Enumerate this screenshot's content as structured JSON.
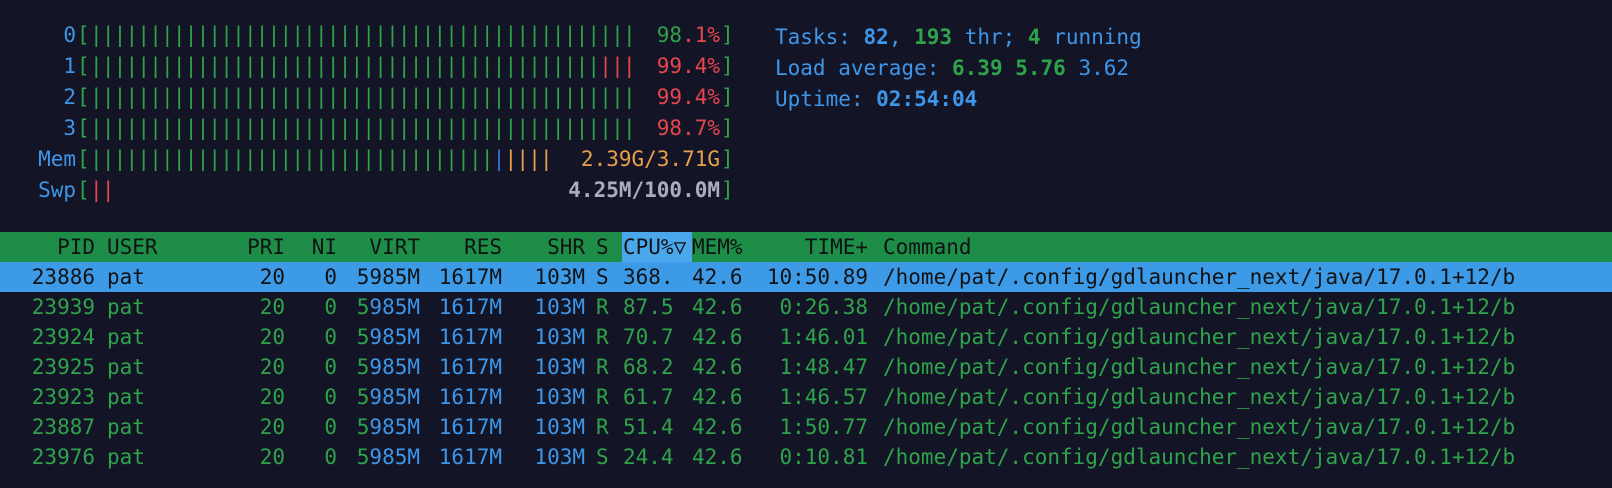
{
  "meters": [
    {
      "label": "0",
      "green": 46,
      "red": 0,
      "blue": 0,
      "yellow": 0,
      "value_pre": "98",
      "value_post": ".1%"
    },
    {
      "label": "1",
      "green": 43,
      "red": 3,
      "blue": 0,
      "yellow": 0,
      "value_pre": "",
      "value_post": "99.4%"
    },
    {
      "label": "2",
      "green": 46,
      "red": 0,
      "blue": 0,
      "yellow": 0,
      "value_pre": "",
      "value_post": "99.4%"
    },
    {
      "label": "3",
      "green": 46,
      "red": 0,
      "blue": 0,
      "yellow": 0,
      "value_pre": "",
      "value_post": "98.7%"
    },
    {
      "label": "Mem",
      "green": 34,
      "red": 0,
      "blue": 1,
      "yellow": 4,
      "value_pre": "",
      "value_post": "2.39G/3.71G"
    },
    {
      "label": "Swp",
      "green": 0,
      "red": 2,
      "blue": 0,
      "yellow": 0,
      "value_pre": "",
      "value_post": "4.25M/100.0M"
    }
  ],
  "info": {
    "tasks_label": "Tasks: ",
    "tasks": "82",
    "sep1": ", ",
    "threads": "193",
    "thr_label": " thr; ",
    "running": "4",
    "running_label": " running",
    "load_label": "Load average: ",
    "load1": "6.39",
    "load5": "5.76",
    "load15": "3.62",
    "uptime_label": "Uptime: ",
    "uptime": "02:54:04"
  },
  "columns": {
    "pid": "PID",
    "user": "USER",
    "pri": "PRI",
    "ni": "NI",
    "virt": "VIRT",
    "res": "RES",
    "shr": "SHR",
    "s": "S",
    "cpu": "CPU%▽",
    "mem": "MEM%",
    "time": "TIME+",
    "command": "Command"
  },
  "processes": [
    {
      "pid": "23886",
      "user": "pat",
      "pri": "20",
      "ni": "0",
      "virt_a": "5",
      "virt_b": "985M",
      "res_a": "1617M",
      "res_b": "",
      "shr": "103M",
      "s": "S",
      "cpu": "368.",
      "mem": "42.6",
      "time": "10:50.89",
      "command": "/home/pat/.config/gdlauncher_next/java/17.0.1+12/b"
    },
    {
      "pid": "23939",
      "user": "pat",
      "pri": "20",
      "ni": "0",
      "virt_a": "5",
      "virt_b": "985M",
      "res_a": "1617M",
      "res_b": "",
      "shr": "103M",
      "s": "R",
      "cpu": "87.5",
      "mem": "42.6",
      "time": "0:26.38",
      "command": "/home/pat/.config/gdlauncher_next/java/17.0.1+12/b"
    },
    {
      "pid": "23924",
      "user": "pat",
      "pri": "20",
      "ni": "0",
      "virt_a": "5",
      "virt_b": "985M",
      "res_a": "1617M",
      "res_b": "",
      "shr": "103M",
      "s": "R",
      "cpu": "70.7",
      "mem": "42.6",
      "time": "1:46.01",
      "command": "/home/pat/.config/gdlauncher_next/java/17.0.1+12/b"
    },
    {
      "pid": "23925",
      "user": "pat",
      "pri": "20",
      "ni": "0",
      "virt_a": "5",
      "virt_b": "985M",
      "res_a": "1617M",
      "res_b": "",
      "shr": "103M",
      "s": "R",
      "cpu": "68.2",
      "mem": "42.6",
      "time": "1:48.47",
      "command": "/home/pat/.config/gdlauncher_next/java/17.0.1+12/b"
    },
    {
      "pid": "23923",
      "user": "pat",
      "pri": "20",
      "ni": "0",
      "virt_a": "5",
      "virt_b": "985M",
      "res_a": "1617M",
      "res_b": "",
      "shr": "103M",
      "s": "R",
      "cpu": "61.7",
      "mem": "42.6",
      "time": "1:46.57",
      "command": "/home/pat/.config/gdlauncher_next/java/17.0.1+12/b"
    },
    {
      "pid": "23887",
      "user": "pat",
      "pri": "20",
      "ni": "0",
      "virt_a": "5",
      "virt_b": "985M",
      "res_a": "1617M",
      "res_b": "",
      "shr": "103M",
      "s": "R",
      "cpu": "51.4",
      "mem": "42.6",
      "time": "1:50.77",
      "command": "/home/pat/.config/gdlauncher_next/java/17.0.1+12/b"
    },
    {
      "pid": "23976",
      "user": "pat",
      "pri": "20",
      "ni": "0",
      "virt_a": "5",
      "virt_b": "985M",
      "res_a": "1617M",
      "res_b": "",
      "shr": "103M",
      "s": "S",
      "cpu": "24.4",
      "mem": "42.6",
      "time": "0:10.81",
      "command": "/home/pat/.config/gdlauncher_next/java/17.0.1+12/b"
    }
  ],
  "colors": {
    "background": "#131527",
    "header_bg": "#1e8d48",
    "selected_bg": "#3d9ae6",
    "sorted_col_bg": "#4aa7ec",
    "green": "#2fa34a",
    "red": "#e8454d",
    "yellow": "#e8a04a",
    "blue": "#3e96e8"
  }
}
